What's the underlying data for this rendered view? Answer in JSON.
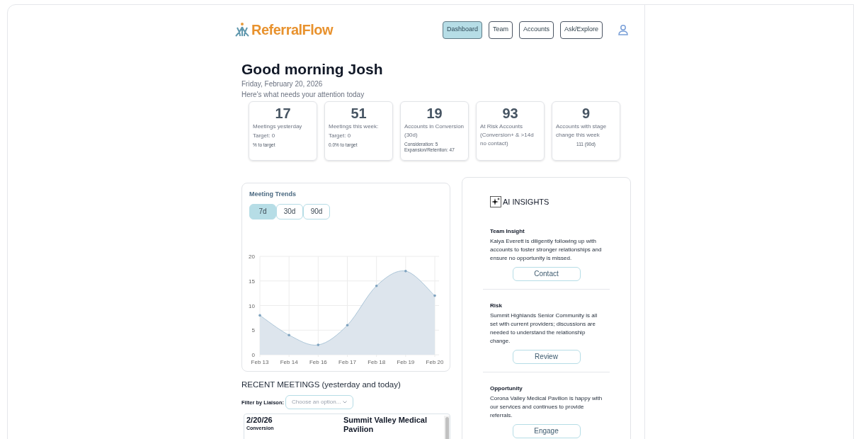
{
  "logo": {
    "text": "ReferralFlow"
  },
  "nav": [
    {
      "label": "Dashboard",
      "selected": true
    },
    {
      "label": "Team",
      "selected": false
    },
    {
      "label": "Accounts",
      "selected": false
    },
    {
      "label": "Ask/Explore",
      "selected": false
    }
  ],
  "greeting": "Good morning Josh",
  "date": "Friday, February 20, 2026",
  "subtitle": "Here's what needs your attention today",
  "stats": [
    {
      "kind": "plain",
      "value": "17",
      "lines": [
        "Meetings yesterday",
        "Target: 0"
      ],
      "notes": [
        "% to target"
      ]
    },
    {
      "kind": "plain",
      "value": "51",
      "lines": [
        "Meetings this week:",
        "Target: 0"
      ],
      "notes": [
        "0.0% to target"
      ]
    },
    {
      "kind": "plain",
      "value": "19",
      "lines": [
        "Accounts in Conversion (30d)"
      ],
      "notes": [
        "Consideration: 5",
        "Expansion/Retention: 47"
      ]
    },
    {
      "kind": "plain",
      "value": "93",
      "lines": [
        "At Risk Accounts (Conversion+ & >14d no contact)"
      ]
    },
    {
      "kind": "summary",
      "value": "9",
      "lines": [
        "Accounts with stage change this week"
      ],
      "notes": [
        "111 (90d)"
      ]
    }
  ],
  "trends": {
    "title": "Meeting Trends",
    "ranges": [
      {
        "label": "7d",
        "selected": true
      },
      {
        "label": "30d",
        "selected": false
      },
      {
        "label": "90d",
        "selected": false
      }
    ],
    "chart_data": {
      "type": "area",
      "categories": [
        "Feb 13",
        "Feb 14",
        "Feb 16",
        "Feb 17",
        "Feb 18",
        "Feb 19",
        "Feb 20"
      ],
      "series": [
        {
          "color": "#8fb3cc",
          "values": [
            8,
            4,
            2,
            6,
            14,
            17,
            12
          ]
        }
      ],
      "ylim": [
        0,
        20
      ],
      "yticks": [
        0,
        5,
        10,
        15,
        20
      ],
      "grid": true
    }
  },
  "recent": {
    "title": "RECENT MEETINGS (yesterday and today)",
    "filter_label": "Filter by Liaison:",
    "filter_placeholder": "Choose an option...",
    "rows": [
      {
        "date": "2/20/26",
        "stage": "Conversion",
        "account": "Summit Valley Medical Pavilion"
      }
    ]
  },
  "insights": {
    "title": "AI INSIGHTS",
    "items": [
      {
        "heading": "Team Insight",
        "text": "Kaiya Everett is diligently following up with accounts to foster stronger relationships and ensure no opportunity is missed.",
        "action": "Contact"
      },
      {
        "heading": "Risk",
        "text": "Summit Highlands Senior Community is all set with current providers; discussions are needed to understand the relationship change.",
        "action": "Review"
      },
      {
        "heading": "Opportunity",
        "text": "Corona Valley Medical Pavilion is happy with our services and continues to provide referrals.",
        "action": "Engage"
      }
    ]
  }
}
